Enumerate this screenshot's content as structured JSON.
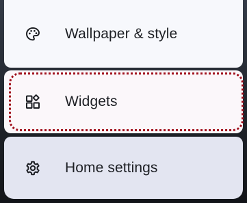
{
  "menu": {
    "items": [
      {
        "label": "Wallpaper & style",
        "icon": "palette-icon"
      },
      {
        "label": "Widgets",
        "icon": "widgets-icon"
      },
      {
        "label": "Home settings",
        "icon": "gear-icon"
      }
    ]
  },
  "highlight": {
    "target": "Widgets",
    "color": "#a0101c"
  },
  "colors": {
    "item_background": "#f7f8fc",
    "selected_item_background": "#e3e5f1",
    "text": "#1d1f24"
  }
}
